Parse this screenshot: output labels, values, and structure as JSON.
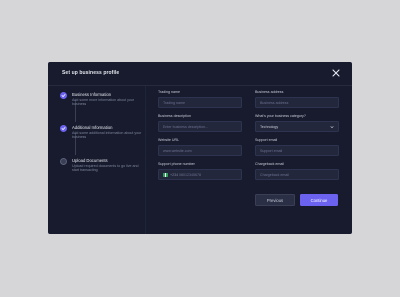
{
  "modal": {
    "title": "Set up business profile"
  },
  "steps": [
    {
      "title": "Business Information",
      "desc": "Add some more information about your business",
      "status": "done"
    },
    {
      "title": "Additional Information",
      "desc": "Add some additional information about your business",
      "status": "done"
    },
    {
      "title": "Upload Documents",
      "desc": "Upload required documents to go live and start transacting",
      "status": "todo"
    }
  ],
  "form": {
    "trading_name": {
      "label": "Trading name",
      "placeholder": "Trading name"
    },
    "business_address": {
      "label": "Business address",
      "placeholder": "Business address"
    },
    "business_description": {
      "label": "Business description",
      "placeholder": "Enter business description..."
    },
    "business_category": {
      "label": "What's your business category?",
      "value": "Technology"
    },
    "website_url": {
      "label": "Website URL",
      "placeholder": "www.website.com"
    },
    "support_email": {
      "label": "Support email",
      "placeholder": "Support email"
    },
    "support_phone": {
      "label": "Support phone number",
      "code": "+234",
      "placeholder": "08012345678"
    },
    "chargeback_email": {
      "label": "Chargeback email",
      "placeholder": "Chargeback email"
    }
  },
  "buttons": {
    "previous": "Previous",
    "continue": "Continue"
  },
  "colors": {
    "accent": "#6b63f0",
    "modal_bg": "#171b2d",
    "page_bg": "#d6d6d8"
  },
  "icons": {
    "close": "close-icon",
    "check": "check-icon",
    "chevron": "chevron-down-icon",
    "flag": "flag-icon"
  }
}
